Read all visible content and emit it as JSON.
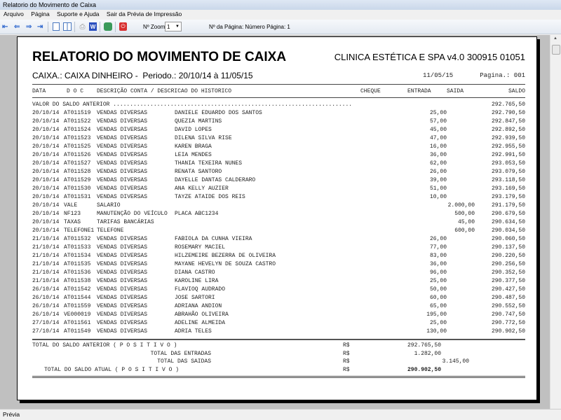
{
  "window": {
    "title": "Relatorio do Movimento de Caixa"
  },
  "menu": [
    "Arquivo",
    "Página",
    "Suporte e Ajuda",
    "Sair da Prévia de Impressão"
  ],
  "toolbar": {
    "zoom_label": "Nº Zoom",
    "zoom_value": "1",
    "page_label": "Nº da Página: Número Página: 1"
  },
  "report": {
    "title": "RELATORIO DO MOVIMENTO DE CAIXA",
    "company": "CLINICA ESTÉTICA E SPA v4.0 300915 01051",
    "subtitle": "CAIXA.: CAIXA DINHEIRO -  Periodo.: 20/10/14 à 11/05/15",
    "date": "11/05/15",
    "page": "Pagina.: 001",
    "headers": {
      "data": "DATA",
      "doc": "D O C",
      "desc": "DESCRIÇÃO CONTA / DESCRICAO DO HISTORICO",
      "cheque": "CHEQUE",
      "entrada": "ENTRADA",
      "saida": "SAIDA",
      "saldo": "SALDO"
    },
    "prev_label": "VALOR DO SALDO ANTERIOR .......................................................................",
    "prev_value": "292.765,50",
    "rows": [
      [
        "20/10/14",
        "AT011519",
        "VENDAS DIVERSAS",
        "DANIELE EDUARDO DOS SANTOS",
        "25,00",
        "",
        "292.790,50"
      ],
      [
        "20/10/14",
        "AT011522",
        "VENDAS DIVERSAS",
        "QUEZIA MARTINS",
        "57,00",
        "",
        "292.847,50"
      ],
      [
        "20/10/14",
        "AT011524",
        "VENDAS DIVERSAS",
        "DAVID LOPES",
        "45,00",
        "",
        "292.892,50"
      ],
      [
        "20/10/14",
        "AT011523",
        "VENDAS DIVERSAS",
        "DILENA SILVA RISE",
        "47,00",
        "",
        "292.939,50"
      ],
      [
        "20/10/14",
        "AT011525",
        "VENDAS DIVERSAS",
        "KAREN BRAGA",
        "16,00",
        "",
        "292.955,50"
      ],
      [
        "20/10/14",
        "AT011526",
        "VENDAS DIVERSAS",
        "LEIA MENDES",
        "36,00",
        "",
        "292.991,50"
      ],
      [
        "20/10/14",
        "AT011527",
        "VENDAS DIVERSAS",
        "THANIA TEXEIRA NUNES",
        "62,00",
        "",
        "293.053,50"
      ],
      [
        "20/10/14",
        "AT011528",
        "VENDAS DIVERSAS",
        "RENATA SANTORO",
        "26,00",
        "",
        "293.079,50"
      ],
      [
        "20/10/14",
        "AT011529",
        "VENDAS DIVERSAS",
        "DAYELLE DANTAS CALDERARO",
        "39,00",
        "",
        "293.118,50"
      ],
      [
        "20/10/14",
        "AT011530",
        "VENDAS DIVERSAS",
        "ANA KELLY AUZIER",
        "51,00",
        "",
        "293.169,50"
      ],
      [
        "20/10/14",
        "AT011531",
        "VENDAS DIVERSAS",
        "TAYZE ATAIDE DOS REIS",
        "10,00",
        "",
        "293.179,50"
      ],
      [
        "20/10/14",
        "VALE",
        "SALARIO",
        "",
        "",
        "2.000,00",
        "291.179,50"
      ],
      [
        "20/10/14",
        "NF123",
        "MANUTENÇÃO DO VEÍCULO",
        "PLACA ABC1234",
        "",
        "500,00",
        "290.679,50"
      ],
      [
        "20/10/14",
        "TAXAS",
        "TARIFAS BANCÁRIAS",
        "",
        "",
        "45,00",
        "290.634,50"
      ],
      [
        "20/10/14",
        "TELEFONE1",
        "TELEFONE",
        "",
        "",
        "600,00",
        "290.034,50"
      ],
      [
        "21/10/14",
        "AT011532",
        "VENDAS DIVERSAS",
        "FABIOLA DA CUNHA VIEIRA",
        "26,00",
        "",
        "290.060,50"
      ],
      [
        "21/10/14",
        "AT011533",
        "VENDAS DIVERSAS",
        "ROSEMARY MACIEL",
        "77,00",
        "",
        "290.137,50"
      ],
      [
        "21/10/14",
        "AT011534",
        "VENDAS DIVERSAS",
        "HILZEMEIRE BEZERRA DE OLIVEIRA",
        "83,00",
        "",
        "290.220,50"
      ],
      [
        "21/10/14",
        "AT011535",
        "VENDAS DIVERSAS",
        "MAYANE HEVELYN DE SOUZA CASTRO",
        "36,00",
        "",
        "290.256,50"
      ],
      [
        "21/10/14",
        "AT011536",
        "VENDAS DIVERSAS",
        "DIANA CASTRO",
        "96,00",
        "",
        "290.352,50"
      ],
      [
        "21/10/14",
        "AT011538",
        "VENDAS DIVERSAS",
        "KAROLINE LIRA",
        "25,00",
        "",
        "290.377,50"
      ],
      [
        "26/10/14",
        "AT011542",
        "VENDAS DIVERSAS",
        "FLAVIOQ AUDRADO",
        "50,00",
        "",
        "290.427,50"
      ],
      [
        "26/10/14",
        "AT011544",
        "VENDAS DIVERSAS",
        "JOSE SARTORI",
        "60,00",
        "",
        "290.487,50"
      ],
      [
        "26/10/14",
        "AT011559",
        "VENDAS DIVERSAS",
        "ADRIANA ANDION",
        "65,00",
        "",
        "290.552,50"
      ],
      [
        "26/10/14",
        "VE000019",
        "VENDAS DIVERSAS",
        "ABRAHÃO OLIVEIRA",
        "195,00",
        "",
        "290.747,50"
      ],
      [
        "27/10/14",
        "AT011561",
        "VENDAS DIVERSAS",
        "ADELINE ALMEIDA",
        "25,00",
        "",
        "290.772,50"
      ],
      [
        "27/10/14",
        "AT011549",
        "VENDAS DIVERSAS",
        "ADRIA TELES",
        "130,00",
        "",
        "290.902,50"
      ]
    ],
    "totals": {
      "prev_label": "TOTAL DO SALDO ANTERIOR ( P O S I T I V O )",
      "prev_value": "292.765,50",
      "in_label": "TOTAL DAS ENTRADAS",
      "in_value": "1.282,00",
      "out_label": "TOTAL DAS SAIDAS",
      "out_value": "3.145,00",
      "cur_label": "TOTAL DO SALDO ATUAL ( P O S I T I V O )",
      "cur_value": "290.902,50",
      "currency": "R$"
    }
  },
  "status": "Prévia"
}
